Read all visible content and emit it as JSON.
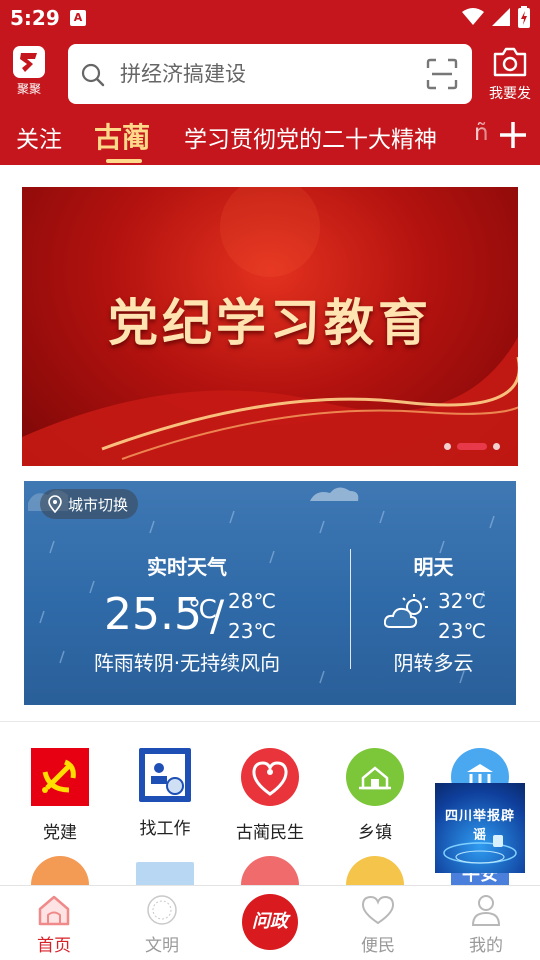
{
  "status_bar": {
    "time": "5:29",
    "notification_icon": "A"
  },
  "header": {
    "logo_label": "聚聚",
    "search_placeholder": "拼经济搞建设",
    "publish_label": "我要发"
  },
  "tabs": [
    {
      "label": "关注",
      "active": false
    },
    {
      "label": "古蔺",
      "active": true
    },
    {
      "label": "学习贯彻党的二十大精神",
      "active": false
    },
    {
      "label": "ñ",
      "active": false
    }
  ],
  "banner": {
    "title": "党纪学习教育",
    "page_count": 3,
    "active_page": 2
  },
  "weather": {
    "city_switch_label": "城市切换",
    "now": {
      "title": "实时天气",
      "temp": "25.5",
      "unit": "℃",
      "slash": "/",
      "high": "28℃",
      "low": "23℃",
      "desc": "阵雨转阴·无持续风向"
    },
    "tomorrow": {
      "title": "明天",
      "high": "32℃",
      "low": "23℃",
      "desc": "阴转多云"
    }
  },
  "grid": [
    {
      "label": "党建",
      "icon": "party-emblem-icon",
      "color": "#e60012"
    },
    {
      "label": "找工作",
      "icon": "job-id-icon",
      "color": "#1e4fb5"
    },
    {
      "label": "古蔺民生",
      "icon": "heart-people-icon",
      "color": "#e8343a"
    },
    {
      "label": "乡镇",
      "icon": "village-icon",
      "color": "#7cc63a"
    },
    {
      "label": "",
      "icon": "government-icon",
      "color": "#4aa8f0"
    }
  ],
  "grid_row2": [
    {
      "icon": "orange-icon",
      "color": "#f39a55"
    },
    {
      "icon": "newspaper-icon",
      "color": "#b7d7f2"
    },
    {
      "icon": "notes-icon",
      "color": "#f06b6b"
    },
    {
      "icon": "hands-icon",
      "color": "#f4c54a"
    },
    {
      "icon": "safety-icon",
      "color": "#4a7fdc",
      "text": "平安"
    }
  ],
  "float_ad": {
    "text": "四川举报辟谣"
  },
  "bottom_nav": [
    {
      "label": "首页",
      "icon": "home-icon",
      "active": true
    },
    {
      "label": "文明",
      "icon": "civilization-icon",
      "active": false
    },
    {
      "label": "问政",
      "icon": "inquiry-icon",
      "active": false
    },
    {
      "label": "便民",
      "icon": "heart-icon",
      "active": false
    },
    {
      "label": "我的",
      "icon": "profile-icon",
      "active": false
    }
  ],
  "colors": {
    "brand_red": "#c4161c",
    "tab_active": "#ffd98a",
    "nav_active": "#d8222a"
  }
}
